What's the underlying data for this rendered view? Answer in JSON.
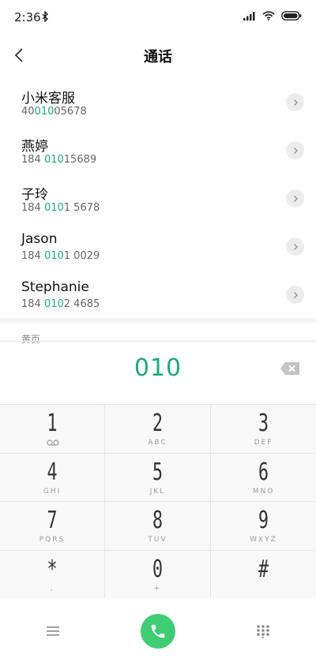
{
  "status_bar": {
    "time": "2:36",
    "icons": [
      "bluetooth-icon",
      "signal-icon",
      "wifi-icon",
      "battery-icon"
    ]
  },
  "header": {
    "title": "通话"
  },
  "results": [
    {
      "name": "小米客服",
      "number_parts": [
        "40",
        "010",
        "05678"
      ]
    },
    {
      "name": "燕婷",
      "number_parts": [
        "184 ",
        "010",
        "15689"
      ]
    },
    {
      "name": "子玲",
      "number_parts": [
        "184 ",
        "010",
        "1 5678"
      ]
    },
    {
      "name": "Jason",
      "number_parts": [
        "184 ",
        "010",
        "1 0029"
      ]
    },
    {
      "name": "Stephanie",
      "number_parts": [
        "184 ",
        "010",
        "2 4685"
      ]
    }
  ],
  "yellow_pages": {
    "label": "黄页"
  },
  "dialer": {
    "number": "010"
  },
  "keypad": [
    {
      "digit": "1",
      "sub": "oo"
    },
    {
      "digit": "2",
      "sub": "ABC"
    },
    {
      "digit": "3",
      "sub": "DEF"
    },
    {
      "digit": "4",
      "sub": "GHI"
    },
    {
      "digit": "5",
      "sub": "JKL"
    },
    {
      "digit": "6",
      "sub": "MNO"
    },
    {
      "digit": "7",
      "sub": "PQRS"
    },
    {
      "digit": "8",
      "sub": "TUV"
    },
    {
      "digit": "9",
      "sub": "WXYZ"
    },
    {
      "digit": "*",
      "sub": ","
    },
    {
      "digit": "0",
      "sub": "+"
    },
    {
      "digit": "#",
      "sub": ""
    }
  ],
  "colors": {
    "accent": "#1aab7a",
    "call_button": "#3fcd74"
  }
}
